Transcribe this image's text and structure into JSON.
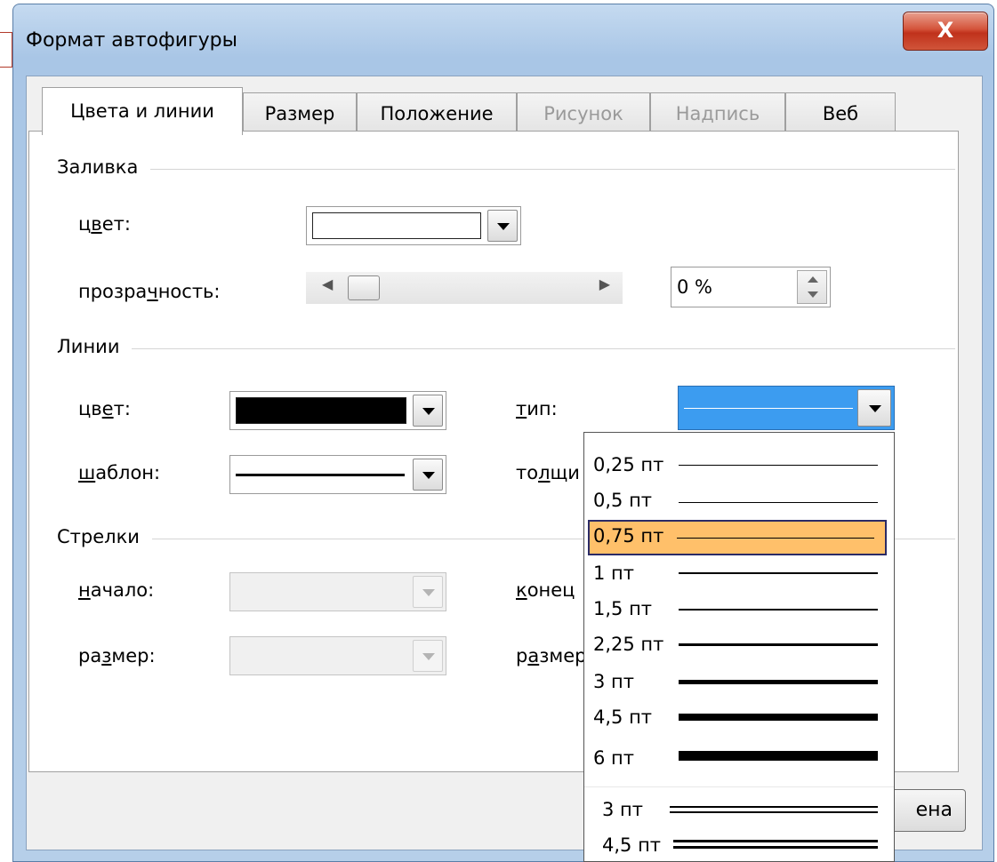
{
  "window": {
    "title": "Формат автофигуры",
    "close_glyph": "X"
  },
  "tabs": [
    {
      "label": "Цвета и линии",
      "state": "active"
    },
    {
      "label": "Размер",
      "state": "normal"
    },
    {
      "label": "Положение",
      "state": "normal"
    },
    {
      "label": "Рисунок",
      "state": "disabled"
    },
    {
      "label": "Надпись",
      "state": "disabled"
    },
    {
      "label": "Веб",
      "state": "normal"
    }
  ],
  "fill": {
    "group": "Заливка",
    "color_label_pre": "ц",
    "color_label_u": "в",
    "color_label_post": "ет:",
    "color_value": "#ffffff",
    "transparency_label_pre": "прозра",
    "transparency_label_u": "ч",
    "transparency_label_post": "ность:",
    "transparency_value": "0 %",
    "transparency_fraction": 0
  },
  "lines": {
    "group": "Линии",
    "color_label_pre": "цв",
    "color_label_u": "е",
    "color_label_post": "т:",
    "color_value": "#000000",
    "pattern_label_u": "ш",
    "pattern_label_post": "аблон:",
    "type_label_u": "т",
    "type_label_post": "ип:",
    "weight_label_pre": "то",
    "weight_label_u": "л",
    "weight_label_post": "щи"
  },
  "arrows": {
    "group": "Стрелки",
    "begin_label_u": "н",
    "begin_label_post": "ачало:",
    "begin_size_label_pre": "ра",
    "begin_size_label_u": "з",
    "begin_size_label_post": "мер:",
    "end_label_u": "к",
    "end_label_post": "онец",
    "end_size_label_pre": "р",
    "end_size_label_u": "а",
    "end_size_label_post": "змер"
  },
  "line_type_dropdown": {
    "selected": "0,75 пт",
    "items": [
      {
        "label": "0,25 пт",
        "style": "single",
        "thickness": 0.25
      },
      {
        "label": "0,5 пт",
        "style": "single",
        "thickness": 0.5
      },
      {
        "label": "0,75 пт",
        "style": "single",
        "thickness": 0.75
      },
      {
        "label": "1 пт",
        "style": "single",
        "thickness": 1
      },
      {
        "label": "1,5 пт",
        "style": "single",
        "thickness": 1.5
      },
      {
        "label": "2,25 пт",
        "style": "single",
        "thickness": 2.25
      },
      {
        "label": "3 пт",
        "style": "single",
        "thickness": 3
      },
      {
        "label": "4,5 пт",
        "style": "single",
        "thickness": 4.5
      },
      {
        "label": "6 пт",
        "style": "single",
        "thickness": 6
      },
      {
        "label": "3 пт",
        "style": "double",
        "thickness": 3
      },
      {
        "label": "4,5 пт",
        "style": "double",
        "thickness": 4.5
      }
    ]
  },
  "partial_button": {
    "label": "ена"
  },
  "colors": {
    "selection_fill": "#ffc06a",
    "selection_border": "#2b2b66",
    "combo_focus": "#3c9cf0",
    "close_button": "#c0311b"
  }
}
